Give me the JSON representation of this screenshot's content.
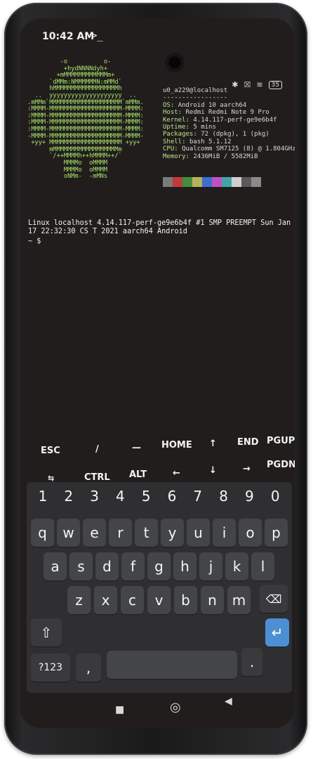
{
  "status": {
    "time": "10:42 AM",
    "terminal_glyph": ">_",
    "icons": [
      "bluetooth-icon",
      "close-box-icon",
      "wifi-icon",
      "battery-icon"
    ],
    "battery": "35"
  },
  "neofetch": {
    "logo_lines": [
      "          -o          o-",
      "           +hydNNNNdyh+",
      "         +mMMMMMMMMMMMMm+",
      "       `dMMm:NMMMMMMN:mMMd`",
      "       hMMMMMMMMMMMMMMMMMMh",
      "   ..  yyyyyyyyyyyyyyyyyyyy  ..",
      " .mMMm`MMMMMMMMMMMMMMMMMMMM`mMMm.",
      " :MMMM-MMMMMMMMMMMMMMMMMMMM-MMMM:",
      " :MMMM-MMMMMMMMMMMMMMMMMMMM-MMMM:",
      " :MMMM-MMMMMMMMMMMMMMMMMMMM-MMMM:",
      " :MMMM-MMMMMMMMMMMMMMMMMMMM-MMMM:",
      " -MMMM-MMMMMMMMMMMMMMMMMMMM-MMMM-",
      "  +yy+ MMMMMMMMMMMMMMMMMMMM +yy+",
      "       mMMMMMMMMMMMMMMMMMMm",
      "       `/++MMMMh++hMMMM++/`",
      "           MMMMo  oMMMM",
      "           MMMMo  oMMMM",
      "           oNMm-  -mMNs"
    ],
    "user_host": "u0_a229@localhost",
    "separator": "-----------------",
    "rows": [
      {
        "key": "OS",
        "value": "Android 10 aarch64"
      },
      {
        "key": "Host",
        "value": "Redmi Redmi Note 9 Pro"
      },
      {
        "key": "Kernel",
        "value": "4.14.117-perf-ge9e6b4f"
      },
      {
        "key": "Uptime",
        "value": "5 mins"
      },
      {
        "key": "Packages",
        "value": "72 (dpkg), 1 (pkg)"
      },
      {
        "key": "Shell",
        "value": "bash 5.1.12"
      },
      {
        "key": "CPU",
        "value": "Qualcomm SM7125 (8) @ 1.804GHz"
      },
      {
        "key": "Memory",
        "value": "2436MiB / 5582MiB"
      }
    ],
    "swatches": [
      "#7a7a7a",
      "#c23b3b",
      "#3f8f3f",
      "#b7b25a",
      "#3b6fd0",
      "#c24fc2",
      "#3fa5a5",
      "#cfcfcf",
      "#595959",
      "#8a8a8a"
    ]
  },
  "terminal": {
    "output": "Linux localhost 4.14.117-perf-ge9e6b4f #1 SMP PREEMPT Sun Jan 17 22:32:30 CS T 2021 aarch64 Android",
    "prompt": "~ $"
  },
  "extra_keys": {
    "row1": [
      "ESC",
      "/",
      "—",
      "HOME",
      "↑",
      "END",
      "PGUP"
    ],
    "row2": [
      "⇆",
      "CTRL",
      "ALT",
      "←",
      "↓",
      "→",
      "PGDN"
    ]
  },
  "keyboard": {
    "numbers": [
      "1",
      "2",
      "3",
      "4",
      "5",
      "6",
      "7",
      "8",
      "9",
      "0"
    ],
    "row1": [
      "q",
      "w",
      "e",
      "r",
      "t",
      "y",
      "u",
      "i",
      "o",
      "p"
    ],
    "row2": [
      "a",
      "s",
      "d",
      "f",
      "g",
      "h",
      "j",
      "k",
      "l"
    ],
    "row3": [
      "z",
      "x",
      "c",
      "v",
      "b",
      "n",
      "m"
    ],
    "shift": "⇧",
    "backspace": "⌫",
    "symbols": "?123",
    "comma": ",",
    "period": ".",
    "enter": "↵"
  },
  "navbar": {
    "recents": "■",
    "home": "◎",
    "back": "◀"
  }
}
